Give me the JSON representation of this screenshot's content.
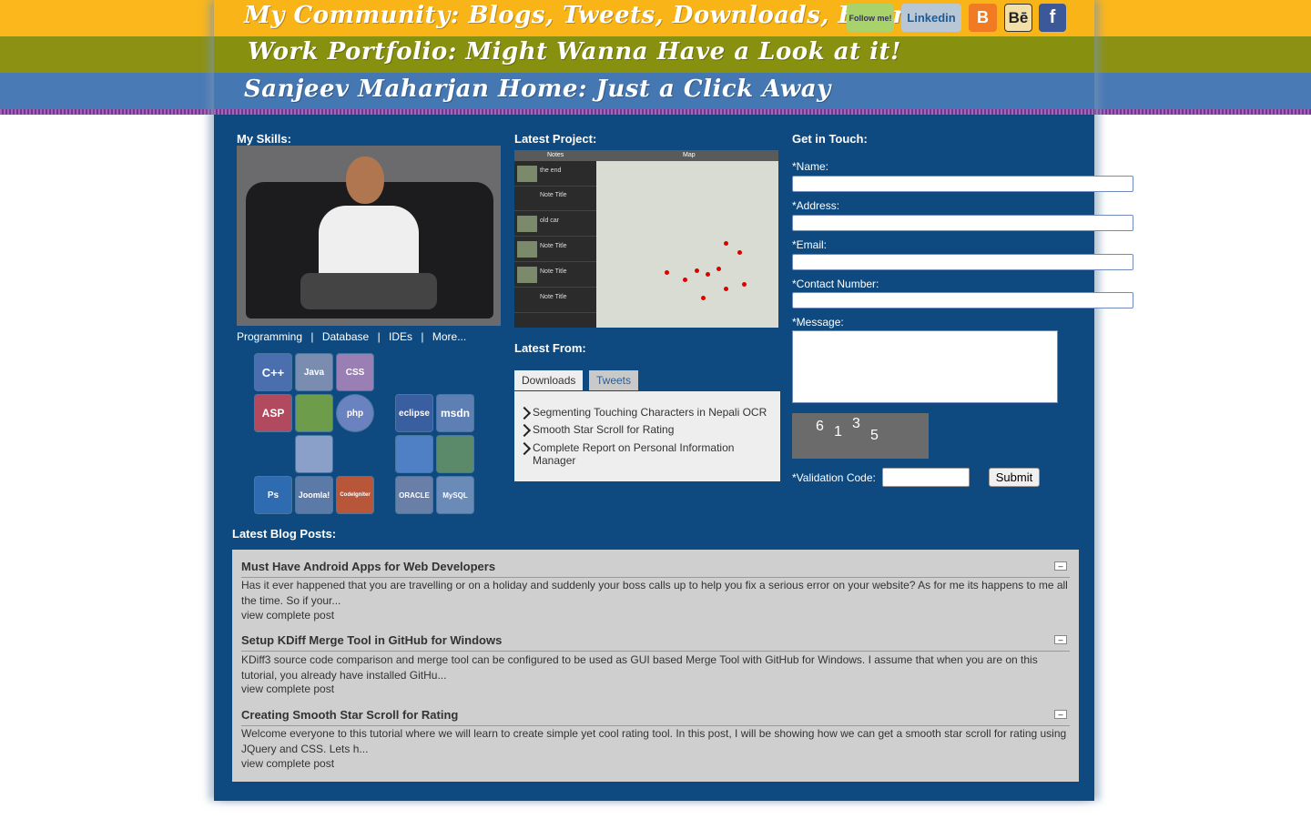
{
  "nav": {
    "line1": "My Community: Blogs, Tweets, Downloads, Friends",
    "line2": "Work Portfolio: Might Wanna Have a Look at it!",
    "line3": "Sanjeev Maharjan Home: Just a Click Away"
  },
  "social": {
    "twitter": "Follow me!",
    "linkedin": "Linkedin",
    "blogger": "B",
    "behance": "Bē",
    "facebook": "f"
  },
  "skills": {
    "heading": "My Skills:",
    "links": [
      "Programming",
      "|",
      "Database",
      "|",
      "IDEs",
      "|",
      "More..."
    ],
    "icons": {
      "cpp": "C++",
      "java": "Java",
      "css": "CSS",
      "asp": "ASP",
      "android": "",
      "php": "php",
      "xml": "",
      "photoshop": "Ps",
      "joomla": "Joomla!",
      "codeigniter": "CodeIgniter",
      "eclipse": "eclipse",
      "msdn": "msdn",
      "cube": "",
      "dev": "",
      "oracle": "ORACLE",
      "mysql": "MySQL"
    }
  },
  "project": {
    "heading": "Latest Project:",
    "screen": {
      "left_title": "Notes",
      "right_title": "Map",
      "rows": [
        "the end",
        "Note Title",
        "old car",
        "Note Title",
        "Note Title",
        "Note Title"
      ]
    }
  },
  "latest": {
    "heading": "Latest From:",
    "tabs": [
      "Downloads",
      "Tweets"
    ],
    "items": [
      "Segmenting Touching Characters in Nepali OCR",
      "Smooth Star Scroll for Rating",
      "Complete Report on Personal Information Manager"
    ]
  },
  "contact": {
    "heading": "Get in Touch:",
    "name_label": "*Name:",
    "address_label": "*Address:",
    "email_label": "*Email:",
    "phone_label": "*Contact Number:",
    "message_label": "*Message:",
    "captcha_digits": [
      "6",
      "1",
      "3",
      "5"
    ],
    "validation_label": "*Validation Code:",
    "submit": "Submit"
  },
  "blog": {
    "heading": "Latest Blog Posts:",
    "posts": [
      {
        "title": "Must Have Android Apps for Web Developers",
        "body": "Has it ever happened that you are travelling or on a holiday and suddenly your boss calls up to help you fix a serious error on your website? As for me its happens to me all the time. So if  your...",
        "link": "view complete post"
      },
      {
        "title": "Setup KDiff Merge Tool in GitHub for Windows",
        "body": "KDiff3 source code comparison and merge tool can be configured to be used as GUI based Merge Tool with GitHub for Windows. I assume that when you are on this tutorial, you already have installed GitHu...",
        "link": "view complete post"
      },
      {
        "title": "Creating Smooth Star Scroll for Rating",
        "body": "Welcome everyone to this tutorial where we will learn to create simple yet cool rating tool. In this post, I will be showing how we can get a smooth star scroll for rating using JQuery and CSS. Lets h...",
        "link": "view complete post"
      }
    ],
    "collapse_symbol": "–"
  }
}
